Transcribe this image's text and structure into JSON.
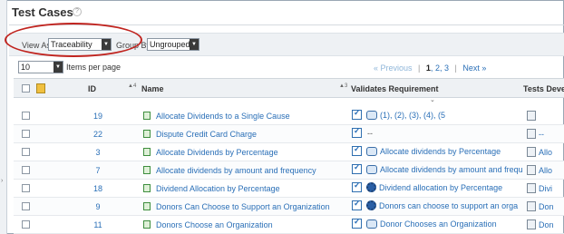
{
  "page": {
    "title": "Test Cases",
    "help_icon": "question-icon"
  },
  "view_bar": {
    "view_as_label": "View As:",
    "view_as_value": "Traceability",
    "group_by_label": "Group By:",
    "group_by_value": "Ungrouped"
  },
  "paging": {
    "per_page_value": "10",
    "per_page_label": "Items per page",
    "previous": "« Previous",
    "sep": "|",
    "pages": [
      "1",
      "2",
      "3"
    ],
    "next": "Next »"
  },
  "columns": {
    "id": "ID",
    "id_sort": "▲4",
    "name": "Name",
    "name_sort": "▲3",
    "validates": "Validates Requirement",
    "tests_dev": "Tests Devel"
  },
  "rows": [
    {
      "id": "19",
      "name": "Allocate Dividends to a Single Cause",
      "validates_text": "(1),  (2),  (3),  (4),  (5",
      "tests_text": ""
    },
    {
      "id": "22",
      "name": "Dispute Credit Card Charge",
      "validates_text": "--",
      "tests_text": "--"
    },
    {
      "id": "3",
      "name": "Allocate Dividends by Percentage",
      "validates_text": "Allocate dividends by Percentage",
      "tests_text": "Allo"
    },
    {
      "id": "7",
      "name": "Allocate dividends by amount and frequency",
      "validates_text": "Allocate dividends by amount and frequ",
      "tests_text": "Allo"
    },
    {
      "id": "18",
      "name": "Dividend Allocation by Percentage",
      "validates_text": "Dividend allocation by Percentage",
      "tests_text": "Divi"
    },
    {
      "id": "9",
      "name": "Donors Can Choose to Support an Organization",
      "validates_text": "Donors can choose to support an orga",
      "tests_text": "Don"
    },
    {
      "id": "11",
      "name": "Donors Choose an Organization",
      "validates_text": "Donor Chooses an Organization",
      "tests_text": "Don"
    }
  ],
  "colors": {
    "link": "#2a6fb7",
    "highlight_oval": "#c0241f"
  }
}
